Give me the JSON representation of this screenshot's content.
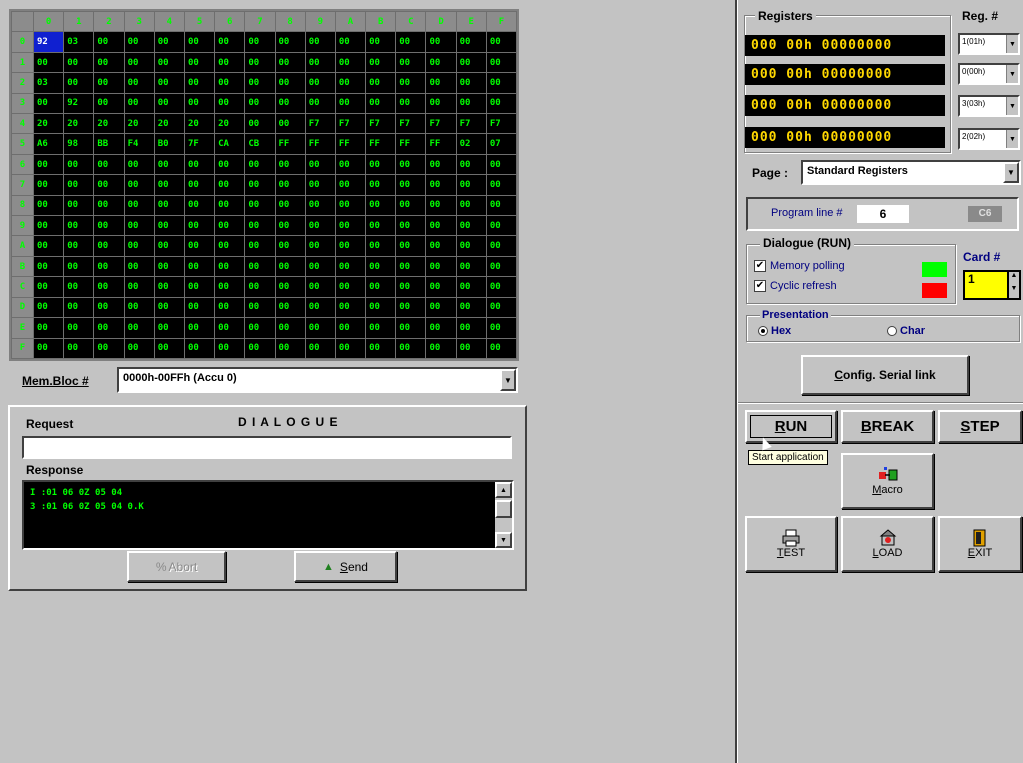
{
  "memory": {
    "col_headers": [
      "0",
      "1",
      "2",
      "3",
      "4",
      "5",
      "6",
      "7",
      "8",
      "9",
      "A",
      "B",
      "C",
      "D",
      "E",
      "F"
    ],
    "row_headers": [
      "0",
      "1",
      "2",
      "3",
      "4",
      "5",
      "6",
      "7",
      "8",
      "9",
      "A",
      "B",
      "C",
      "D",
      "E",
      "F"
    ],
    "rows": [
      [
        "92",
        "03",
        "00",
        "00",
        "00",
        "00",
        "00",
        "00",
        "00",
        "00",
        "00",
        "00",
        "00",
        "00",
        "00",
        "00"
      ],
      [
        "00",
        "00",
        "00",
        "00",
        "00",
        "00",
        "00",
        "00",
        "00",
        "00",
        "00",
        "00",
        "00",
        "00",
        "00",
        "00"
      ],
      [
        "03",
        "00",
        "00",
        "00",
        "00",
        "00",
        "00",
        "00",
        "00",
        "00",
        "00",
        "00",
        "00",
        "00",
        "00",
        "00"
      ],
      [
        "00",
        "92",
        "00",
        "00",
        "00",
        "00",
        "00",
        "00",
        "00",
        "00",
        "00",
        "00",
        "00",
        "00",
        "00",
        "00"
      ],
      [
        "20",
        "20",
        "20",
        "20",
        "20",
        "20",
        "20",
        "00",
        "00",
        "F7",
        "F7",
        "F7",
        "F7",
        "F7",
        "F7",
        "F7"
      ],
      [
        "A6",
        "98",
        "BB",
        "F4",
        "B0",
        "7F",
        "CA",
        "CB",
        "FF",
        "FF",
        "FF",
        "FF",
        "FF",
        "FF",
        "02",
        "07"
      ],
      [
        "00",
        "00",
        "00",
        "00",
        "00",
        "00",
        "00",
        "00",
        "00",
        "00",
        "00",
        "00",
        "00",
        "00",
        "00",
        "00"
      ],
      [
        "00",
        "00",
        "00",
        "00",
        "00",
        "00",
        "00",
        "00",
        "00",
        "00",
        "00",
        "00",
        "00",
        "00",
        "00",
        "00"
      ],
      [
        "00",
        "00",
        "00",
        "00",
        "00",
        "00",
        "00",
        "00",
        "00",
        "00",
        "00",
        "00",
        "00",
        "00",
        "00",
        "00"
      ],
      [
        "00",
        "00",
        "00",
        "00",
        "00",
        "00",
        "00",
        "00",
        "00",
        "00",
        "00",
        "00",
        "00",
        "00",
        "00",
        "00"
      ],
      [
        "00",
        "00",
        "00",
        "00",
        "00",
        "00",
        "00",
        "00",
        "00",
        "00",
        "00",
        "00",
        "00",
        "00",
        "00",
        "00"
      ],
      [
        "00",
        "00",
        "00",
        "00",
        "00",
        "00",
        "00",
        "00",
        "00",
        "00",
        "00",
        "00",
        "00",
        "00",
        "00",
        "00"
      ],
      [
        "00",
        "00",
        "00",
        "00",
        "00",
        "00",
        "00",
        "00",
        "00",
        "00",
        "00",
        "00",
        "00",
        "00",
        "00",
        "00"
      ],
      [
        "00",
        "00",
        "00",
        "00",
        "00",
        "00",
        "00",
        "00",
        "00",
        "00",
        "00",
        "00",
        "00",
        "00",
        "00",
        "00"
      ],
      [
        "00",
        "00",
        "00",
        "00",
        "00",
        "00",
        "00",
        "00",
        "00",
        "00",
        "00",
        "00",
        "00",
        "00",
        "00",
        "00"
      ],
      [
        "00",
        "00",
        "00",
        "00",
        "00",
        "00",
        "00",
        "00",
        "00",
        "00",
        "00",
        "00",
        "00",
        "00",
        "00",
        "00"
      ]
    ],
    "selected_cell_color": "#1020d0",
    "text_color": "#00ff00"
  },
  "mem_bloc": {
    "label": "Mem.Bloc #",
    "value": "0000h-00FFh (Accu 0)"
  },
  "dialogue": {
    "title": "D I A L O G U E",
    "request_label": "Request",
    "request_value": "",
    "response_label": "Response",
    "response_lines": [
      "I :01 06 0Z 05 04",
      "3 :01 06 0Z 05 04 0.K"
    ],
    "abort_label": "Abort",
    "send_label": "Send"
  },
  "registers": {
    "group_label": "Registers",
    "reg_label": "Reg. #",
    "values": [
      "000 00h 00000000",
      "000 00h 00000000",
      "000 00h 00000000",
      "000 00h 00000000"
    ],
    "reg_selects": [
      "1(01h)",
      "0(00h)",
      "3(03h)",
      "2(02h)"
    ]
  },
  "page": {
    "label": "Page :",
    "value": "Standard Registers"
  },
  "program": {
    "label": "Program line #",
    "value": "6",
    "badge": "C6"
  },
  "dialogue_run": {
    "group_label": "Dialogue (RUN)",
    "memory_polling_label": "Memory polling",
    "memory_polling_checked": true,
    "memory_polling_color": "#00ff00",
    "cyclic_refresh_label": "Cyclic refresh",
    "cyclic_refresh_checked": true,
    "cyclic_refresh_color": "#ff0000"
  },
  "card": {
    "label": "Card #",
    "value": "1"
  },
  "presentation": {
    "label": "Presentation",
    "hex_label": "Hex",
    "char_label": "Char",
    "selected": "Hex"
  },
  "config_serial_label": "Config. Serial link",
  "controls": {
    "run": "RUN",
    "break": "BREAK",
    "step": "STEP",
    "tooltip": "Start application",
    "macro": "Macro",
    "test": "TEST",
    "load": "LOAD",
    "exit": "EXIT"
  }
}
